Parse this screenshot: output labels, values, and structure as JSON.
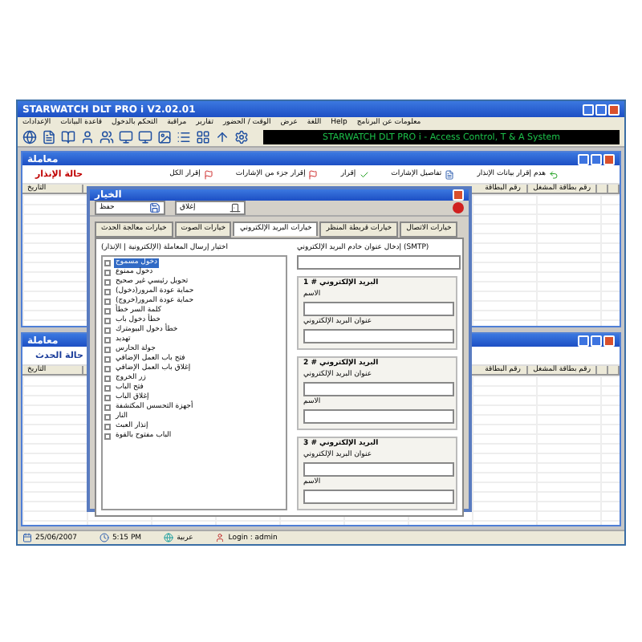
{
  "window": {
    "title": "STARWATCH DLT PRO i V2.02.01"
  },
  "menu": [
    "معلومات عن البرنامج",
    "Help",
    "اللغة",
    "عرض",
    "الوقت / الحضور",
    "تقارير",
    "مراقبة",
    "التحكم بالدخول",
    "قاعدة البيانات",
    "الإعدادات"
  ],
  "banner": "STARWATCH DLT PRO i - Access Control, T & A System",
  "alarm_window": {
    "title": "معاملة",
    "heading": "حالة الإنذار",
    "actions": [
      {
        "label": "هدم إقرار بيانات الإنذار",
        "kind": "undo"
      },
      {
        "label": "تفاصيل الإشارات",
        "kind": "details"
      },
      {
        "label": "إقرار",
        "kind": "check"
      },
      {
        "label": "إقرار جزء من الإشارات",
        "kind": "flag"
      },
      {
        "label": "إقرار الكل",
        "kind": "flag"
      }
    ],
    "columns_left": [
      "التاريخ"
    ],
    "columns_right": [
      "رقم بطاقة المشغل",
      "رقم البطاقة"
    ]
  },
  "options_dialog": {
    "title": "الخيار",
    "buttons": [
      {
        "label": "إغلاق",
        "kind": "close"
      },
      {
        "label": "حفظ",
        "kind": "save"
      }
    ],
    "tabs": [
      {
        "label": "خيارات الاتصال",
        "selected": false
      },
      {
        "label": "خيارات قريطة المنظر",
        "selected": false
      },
      {
        "label": "خيارات البريد الإلكتروني",
        "selected": true
      },
      {
        "label": "خيارات الصوت",
        "selected": false
      },
      {
        "label": "خيارات معالجة الحدث",
        "selected": false
      }
    ],
    "events_label": "اختيار إرسال المعاملة (الإلكترونية | الإنذار)",
    "events": [
      {
        "label": "دخول مسموح",
        "checked": false,
        "selected": true
      },
      {
        "label": "دخول ممنوع",
        "checked": false,
        "selected": false
      },
      {
        "label": "تحويل رئيسي غير صحيح",
        "checked": false,
        "selected": false
      },
      {
        "label": "حماية عودة المرور(دخول)",
        "checked": false,
        "selected": false
      },
      {
        "label": "حماية عودة المرور(خروج)",
        "checked": false,
        "selected": false
      },
      {
        "label": "كلمة السر خطأ",
        "checked": false,
        "selected": false
      },
      {
        "label": "خطأ دخول باب",
        "checked": false,
        "selected": false
      },
      {
        "label": "خطأ دخول البيومترك",
        "checked": false,
        "selected": false
      },
      {
        "label": "تهديد",
        "checked": false,
        "selected": false
      },
      {
        "label": "جولة الحارس",
        "checked": false,
        "selected": false
      },
      {
        "label": "فتح باب العمل الإضافي",
        "checked": false,
        "selected": false
      },
      {
        "label": "إغلاق باب العمل الإضافي",
        "checked": false,
        "selected": false
      },
      {
        "label": "زر الخروج",
        "checked": false,
        "selected": false
      },
      {
        "label": "فتح الباب",
        "checked": false,
        "selected": false
      },
      {
        "label": "إغلاق الباب",
        "checked": false,
        "selected": false
      },
      {
        "label": "أجهزة التحسس المكتشفة",
        "checked": false,
        "selected": false
      },
      {
        "label": "النار",
        "checked": false,
        "selected": false
      },
      {
        "label": "إنذار العبث",
        "checked": false,
        "selected": false
      },
      {
        "label": "الباب مفتوح بالقوة",
        "checked": false,
        "selected": false
      }
    ],
    "smtp_label": "إدخال عنوان خادم البريد الإلكتروني (SMTP)",
    "groups": [
      {
        "title": "البريد الإلكتروني # 1",
        "fields": [
          {
            "label": "الاسم"
          },
          {
            "label": "عنوان البريد الإلكتروني"
          }
        ]
      },
      {
        "title": "البريد الإلكتروني # 2",
        "fields": [
          {
            "label": "عنوان البريد الإلكتروني"
          },
          {
            "label": "الاسم"
          }
        ]
      },
      {
        "title": "البريد الإلكتروني # 3",
        "fields": [
          {
            "label": "عنوان البريد الإلكتروني"
          },
          {
            "label": "الاسم"
          }
        ]
      }
    ]
  },
  "event_window": {
    "title": "معاملة",
    "heading": "حالة الحدث",
    "columns_left": [
      "التاريخ"
    ],
    "columns_right": [
      "رقم بطاقة المشغل",
      "رقم البطاقة"
    ]
  },
  "status_bar": {
    "date": "25/06/2007",
    "time": "5:15 PM",
    "language": "عربية",
    "login": "Login : admin"
  }
}
